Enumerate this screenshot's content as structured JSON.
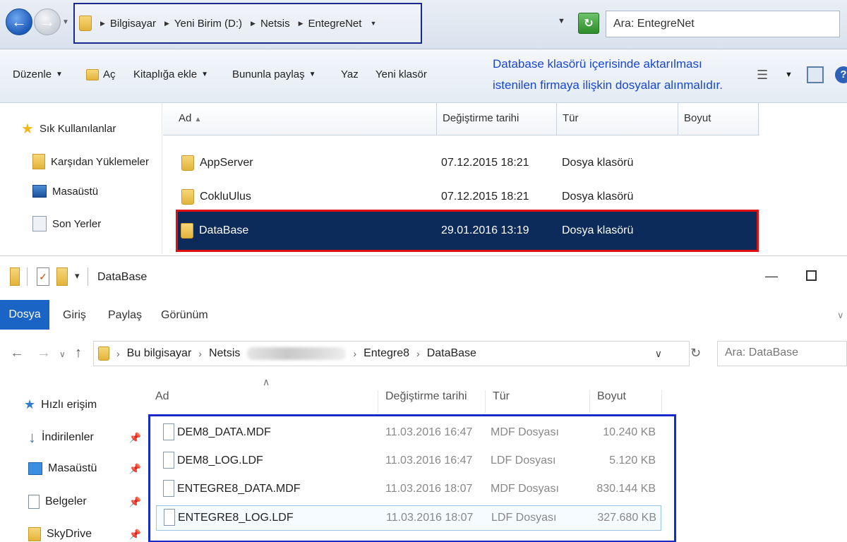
{
  "top": {
    "breadcrumb": [
      "Bilgisayar",
      "Yeni Birim (D:)",
      "Netsis",
      "EntegreNet"
    ],
    "search_placeholder": "Ara: EntegreNet",
    "toolbar": {
      "organize": "Düzenle",
      "open": "Aç",
      "include_library": "Kitaplığa ekle",
      "share": "Bununla paylaş",
      "burn": "Yaz",
      "new_folder": "Yeni klasör"
    },
    "note_line1": "Database klasörü içerisinde aktarılması",
    "note_line2": "istenilen firmaya ilişkin dosyalar alınmalıdır.",
    "nav": {
      "favorites": "Sık Kullanılanlar",
      "downloads": "Karşıdan Yüklemeler",
      "desktop": "Masaüstü",
      "recent": "Son Yerler"
    },
    "columns": {
      "name": "Ad",
      "modified": "Değiştirme tarihi",
      "type": "Tür",
      "size": "Boyut"
    },
    "rows": [
      {
        "name": "AppServer",
        "modified": "07.12.2015 18:21",
        "type": "Dosya klasörü"
      },
      {
        "name": "CokluUlus",
        "modified": "07.12.2015 18:21",
        "type": "Dosya klasörü"
      },
      {
        "name": "DataBase",
        "modified": "29.01.2016 13:19",
        "type": "Dosya klasörü"
      }
    ]
  },
  "bottom": {
    "title": "DataBase",
    "tabs": {
      "file": "Dosya",
      "home": "Giriş",
      "share": "Paylaş",
      "view": "Görünüm"
    },
    "breadcrumb": {
      "this_pc": "Bu bilgisayar",
      "netsis": "Netsis",
      "entegre8": "Entegre8",
      "database": "DataBase"
    },
    "search_placeholder": "Ara: DataBase",
    "nav": {
      "quick_access": "Hızlı erişim",
      "downloads": "İndirilenler",
      "desktop": "Masaüstü",
      "documents": "Belgeler",
      "skydrive": "SkyDrive"
    },
    "columns": {
      "name": "Ad",
      "modified": "Değiştirme tarihi",
      "type": "Tür",
      "size": "Boyut"
    },
    "rows": [
      {
        "name": "DEM8_DATA.MDF",
        "modified": "11.03.2016 16:47",
        "type": "MDF Dosyası",
        "size": "10.240 KB"
      },
      {
        "name": "DEM8_LOG.LDF",
        "modified": "11.03.2016 16:47",
        "type": "LDF Dosyası",
        "size": "5.120 KB"
      },
      {
        "name": "ENTEGRE8_DATA.MDF",
        "modified": "11.03.2016 18:07",
        "type": "MDF Dosyası",
        "size": "830.144 KB"
      },
      {
        "name": "ENTEGRE8_LOG.LDF",
        "modified": "11.03.2016 18:07",
        "type": "LDF Dosyası",
        "size": "327.680 KB"
      }
    ]
  }
}
